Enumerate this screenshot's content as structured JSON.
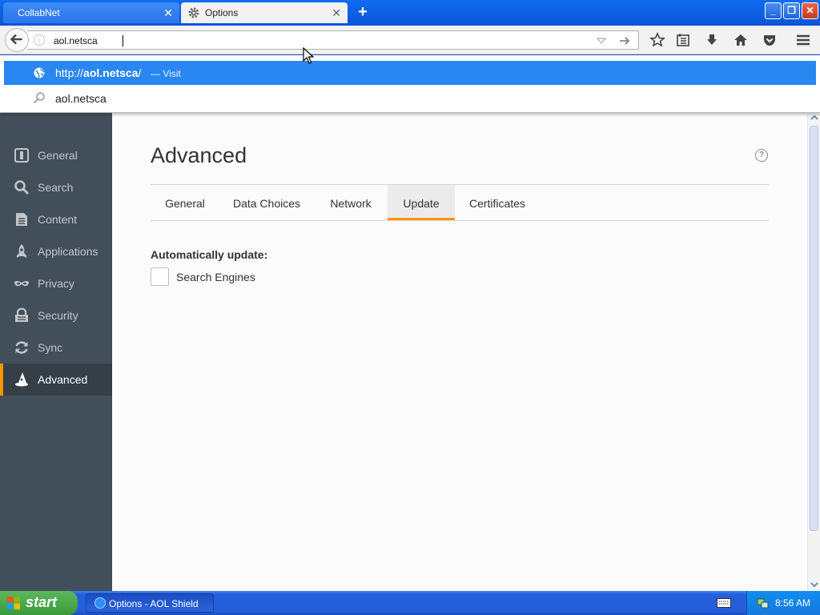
{
  "browser": {
    "tabs": [
      {
        "title": "CollabNet",
        "active": false
      },
      {
        "title": "Options",
        "active": true
      }
    ],
    "url_input_value": "aol.netsca"
  },
  "autocomplete": {
    "visit_url_prefix": "http://",
    "visit_url_bold": "aol.netsca",
    "visit_url_suffix": "/",
    "visit_action": "— Visit",
    "search_text": "aol.netsca"
  },
  "sidebar": {
    "items": [
      {
        "label": "General",
        "icon": "general-icon"
      },
      {
        "label": "Search",
        "icon": "search-icon"
      },
      {
        "label": "Content",
        "icon": "content-icon"
      },
      {
        "label": "Applications",
        "icon": "applications-icon"
      },
      {
        "label": "Privacy",
        "icon": "privacy-mask-icon"
      },
      {
        "label": "Security",
        "icon": "security-icon"
      },
      {
        "label": "Sync",
        "icon": "sync-icon"
      },
      {
        "label": "Advanced",
        "icon": "advanced-icon",
        "selected": true
      }
    ]
  },
  "main": {
    "title": "Advanced",
    "tabs": [
      {
        "label": "General"
      },
      {
        "label": "Data Choices"
      },
      {
        "label": "Network"
      },
      {
        "label": "Update",
        "selected": true
      },
      {
        "label": "Certificates"
      }
    ],
    "section_label": "Automatically update:",
    "checkbox_label": "Search Engines",
    "checkbox_checked": false
  },
  "taskbar": {
    "start_label": "start",
    "task_label": "Options - AOL Shield",
    "clock": "8:56 AM"
  },
  "colors": {
    "accent_orange": "#ff9500",
    "selection_blue": "#2a86f0",
    "sidebar_bg": "#424f5a"
  }
}
